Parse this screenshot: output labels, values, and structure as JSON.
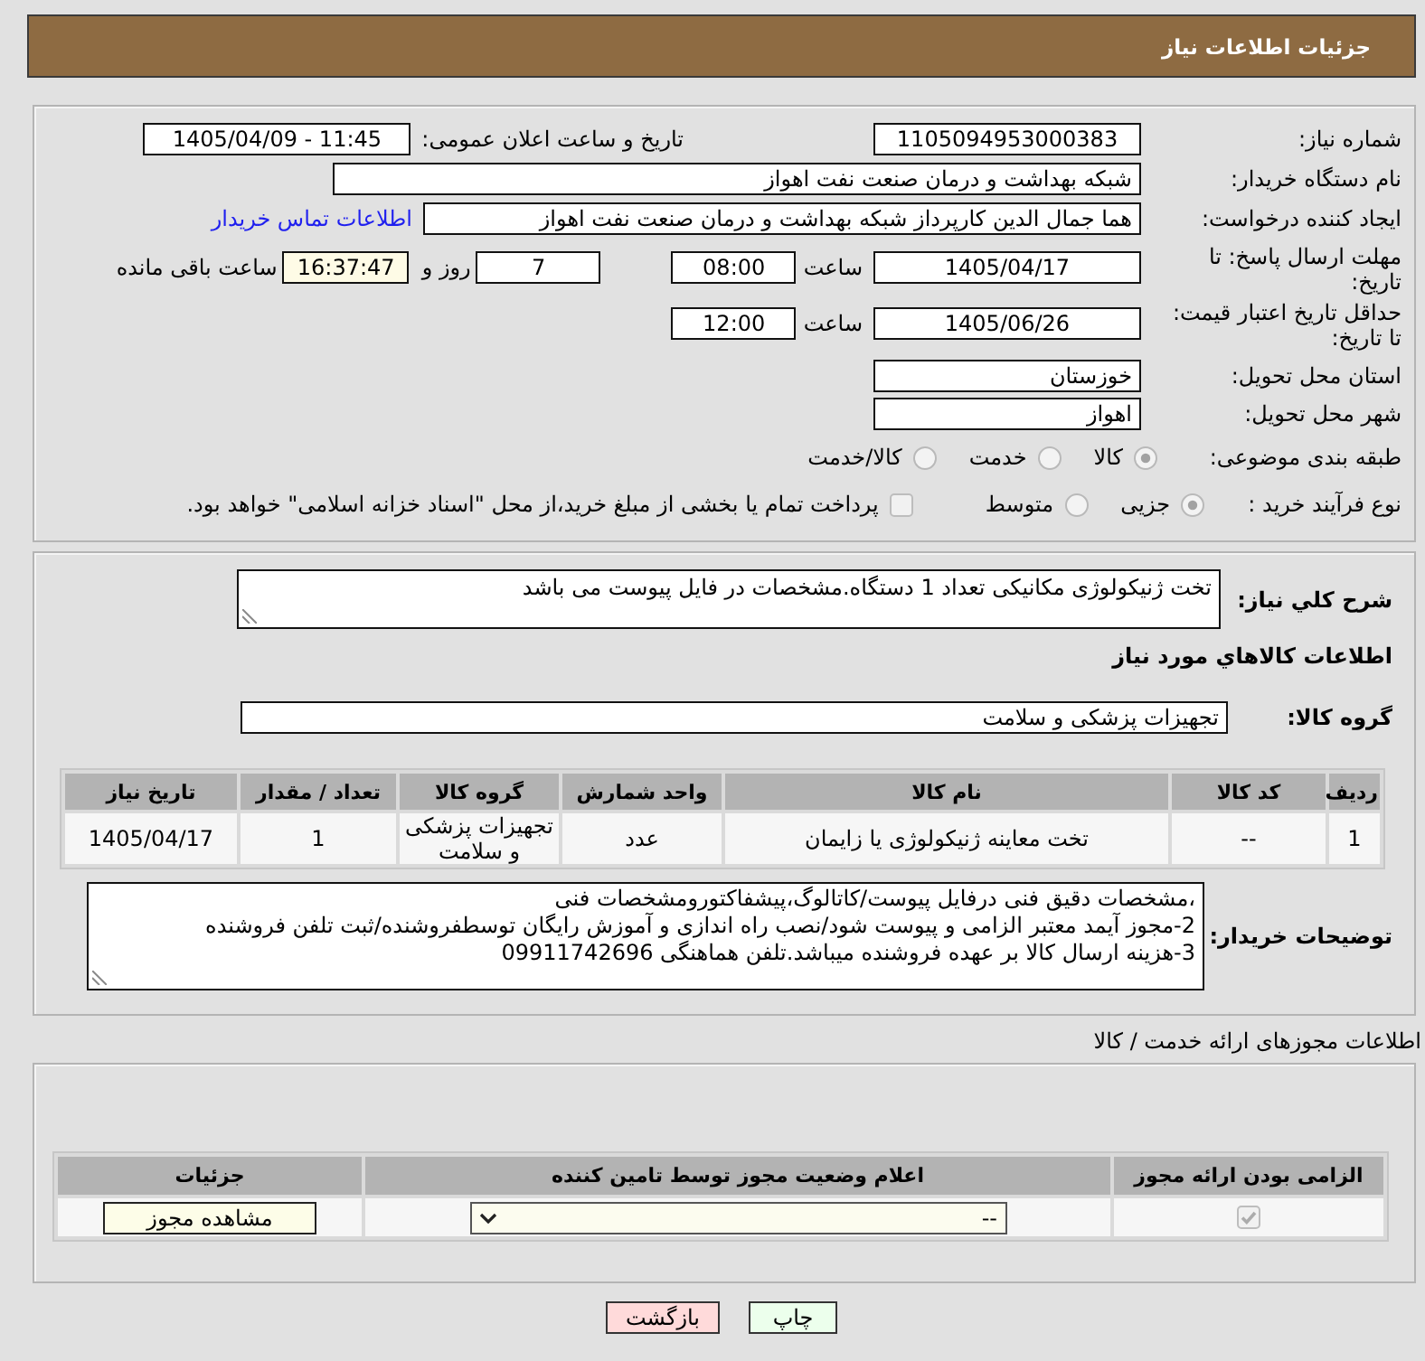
{
  "header": {
    "title": "جزئیات اطلاعات نیاز"
  },
  "need": {
    "need_number": {
      "label": "شماره نیاز:",
      "value": "1105094953000383"
    },
    "announce_datetime": {
      "label": "تاریخ و ساعت اعلان عمومی:",
      "value": "1405/04/09 - 11:45"
    },
    "buyer_org": {
      "label": "نام دستگاه خریدار:",
      "value": "شبکه بهداشت و درمان صنعت نفت اهواز"
    },
    "requester": {
      "label": "ایجاد کننده درخواست:",
      "value": "هما جمال الدین کارپرداز شبکه بهداشت و درمان صنعت نفت اهواز",
      "link": "اطلاعات تماس خریدار"
    },
    "response_deadline": {
      "label": "مهلت ارسال پاسخ: تا تاریخ:",
      "date": "1405/04/17",
      "time_label": "ساعت",
      "time": "08:00",
      "days": "7",
      "days_label": "روز و",
      "remaining": "16:37:47",
      "remaining_label": "ساعت باقی مانده"
    },
    "price_validity": {
      "label": "حداقل تاریخ اعتبار قیمت: تا تاریخ:",
      "date": "1405/06/26",
      "time_label": "ساعت",
      "time": "12:00"
    },
    "province": {
      "label": "استان محل تحویل:",
      "value": "خوزستان"
    },
    "city": {
      "label": "شهر محل تحویل:",
      "value": "اهواز"
    },
    "category": {
      "label": "طبقه بندی موضوعی:",
      "options": [
        {
          "label": "کالا",
          "selected": true
        },
        {
          "label": "خدمت",
          "selected": false
        },
        {
          "label": "کالا/خدمت",
          "selected": false
        }
      ]
    },
    "purchase_type": {
      "label": "نوع فرآیند خرید :",
      "options": [
        {
          "label": "جزیی",
          "selected": true
        },
        {
          "label": "متوسط",
          "selected": false
        }
      ],
      "treasury": {
        "label": "پرداخت تمام یا بخشی از مبلغ خرید،از محل \"اسناد خزانه اسلامی\" خواهد بود.",
        "checked": false
      }
    }
  },
  "request": {
    "description": {
      "label": "شرح كلي نياز:",
      "value": "تخت ژنیکولوژی مکانیکی تعداد 1 دستگاه.مشخصات در فایل پیوست می باشد"
    },
    "items_title": "اطلاعات كالاهاي مورد نياز",
    "group": {
      "label": "گروه کالا:",
      "value": "تجهیزات پزشکی و سلامت"
    },
    "items_table": {
      "columns": [
        "ردیف",
        "کد کالا",
        "نام کالا",
        "واحد شمارش",
        "گروه کالا",
        "تعداد / مقدار",
        "تاریخ نیاز"
      ],
      "rows": [
        [
          "1",
          "--",
          "تخت معاینه ژنیکولوژی یا زایمان",
          "عدد",
          "تجهیزات پزشکی و سلامت",
          "1",
          "1405/04/17"
        ]
      ]
    },
    "buyer_notes": {
      "label": "توضیحات خریدار:",
      "lines": [
        "،مشخصات دقیق فنی درفایل پیوست/کاتالوگ،پیشفاکتورومشخصات فنی",
        "2-مجوز آیمد معتبر الزامی و پیوست شود/نصب راه اندازی و آموزش رایگان توسطفروشنده/ثبت تلفن فروشنده",
        "3-هزینه ارسال کالا بر عهده فروشنده میباشد.تلفن هماهنگی 09911742696"
      ]
    }
  },
  "licenses": {
    "title": "اطلاعات مجوزهای ارائه خدمت / کالا",
    "columns": [
      "الزامی بودن ارائه مجوز",
      "اعلام وضعیت مجوز توسط تامین کننده",
      "جزئیات"
    ],
    "rows": [
      {
        "checked": true,
        "status": "--",
        "action": "مشاهده مجوز"
      }
    ]
  },
  "buttons": [
    {
      "kind": "print",
      "label": "چاپ"
    },
    {
      "kind": "back",
      "label": "بازگشت"
    }
  ]
}
